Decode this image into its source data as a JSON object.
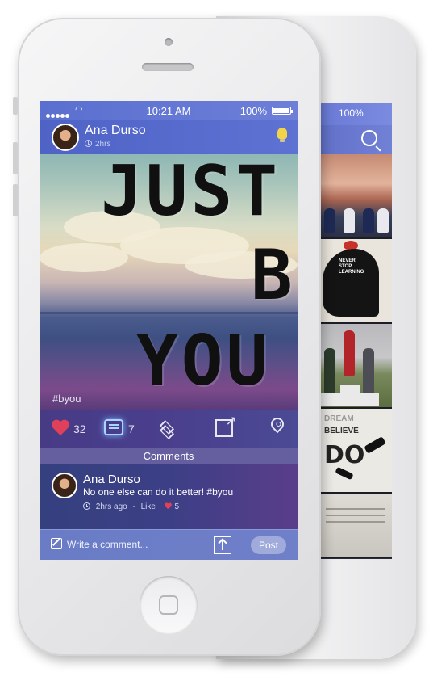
{
  "back_phone": {
    "battery_pct": "100%",
    "search_icon": "search-icon",
    "thumb2_text": "NEVER\nSTOP\nLEARNING",
    "thumb4_line1": "DREAM",
    "thumb4_line2": "BELIEVE",
    "thumb4_line3": "DO"
  },
  "status_bar": {
    "time": "10:21 AM",
    "battery_pct": "100%"
  },
  "post": {
    "author": "Ana Durso",
    "time": "2hrs",
    "image_text_line1": "JUST",
    "image_text_line2": "B",
    "image_text_line3": "YOU",
    "hashtag": "#byou",
    "likes": "32",
    "comments": "7"
  },
  "comments_section": {
    "header": "Comments",
    "items": [
      {
        "author": "Ana Durso",
        "text": "No one else can do it better! #byou",
        "time": "2hrs ago",
        "separator": "-",
        "like_label": "Like",
        "likes": "5"
      }
    ]
  },
  "composer": {
    "placeholder": "Write a comment...",
    "post_label": "Post"
  },
  "colors": {
    "heart": "#e0405a",
    "accent_blue": "#5a6fcf",
    "comment_glow": "#a8d4ff"
  }
}
